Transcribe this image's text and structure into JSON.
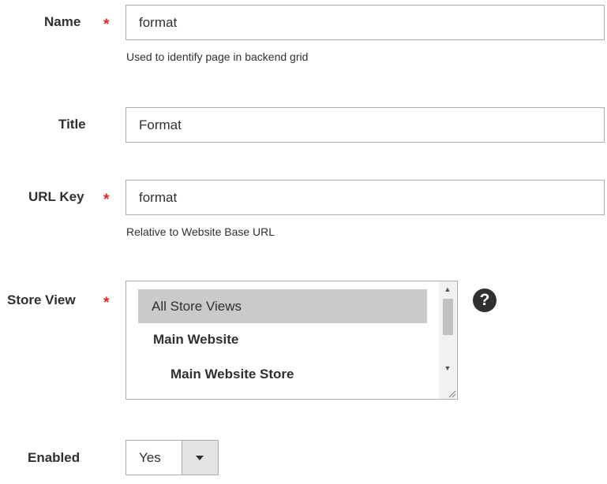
{
  "form": {
    "name": {
      "label": "Name",
      "required_mark": "*",
      "value": "format",
      "note": "Used to identify page in backend grid"
    },
    "title": {
      "label": "Title",
      "value": "Format"
    },
    "url_key": {
      "label": "URL Key",
      "required_mark": "*",
      "value": "format",
      "note": "Relative to Website Base URL"
    },
    "store_view": {
      "label": "Store View",
      "required_mark": "*",
      "options": [
        {
          "label": "All Store Views",
          "selected": true
        },
        {
          "label": "Main Website",
          "selected": false
        },
        {
          "label": "Main Website Store",
          "selected": false
        }
      ],
      "help_icon": "question-circle-icon",
      "help_glyph": "?"
    },
    "enabled": {
      "label": "Enabled",
      "value": "Yes"
    }
  },
  "colors": {
    "required": "#e22626",
    "border": "#adadad",
    "selected_option_bg": "#cacaca",
    "select_button_bg": "#e3e3e3",
    "text": "#303030"
  }
}
